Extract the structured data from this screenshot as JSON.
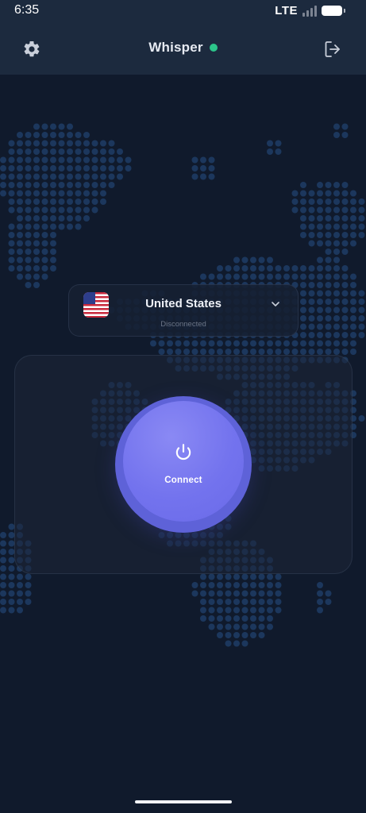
{
  "status_bar": {
    "time": "6:35",
    "network": "LTE",
    "signal_icon": "signal-bars-icon",
    "battery_icon": "battery-icon"
  },
  "header": {
    "title": "Whisper",
    "status_color": "#2cc58a",
    "settings_icon": "gear-icon",
    "logout_icon": "logout-icon"
  },
  "server": {
    "country": "United States",
    "status": "Disconnected",
    "flag_icon": "us-flag-icon",
    "expand_icon": "chevron-down-icon"
  },
  "connect": {
    "label": "Connect",
    "icon": "power-icon",
    "accent_color": "#7373ee"
  },
  "theme": {
    "background": "#101a2c",
    "header_background": "#1c2a3e",
    "map_dot_color": "#1f3d66"
  }
}
